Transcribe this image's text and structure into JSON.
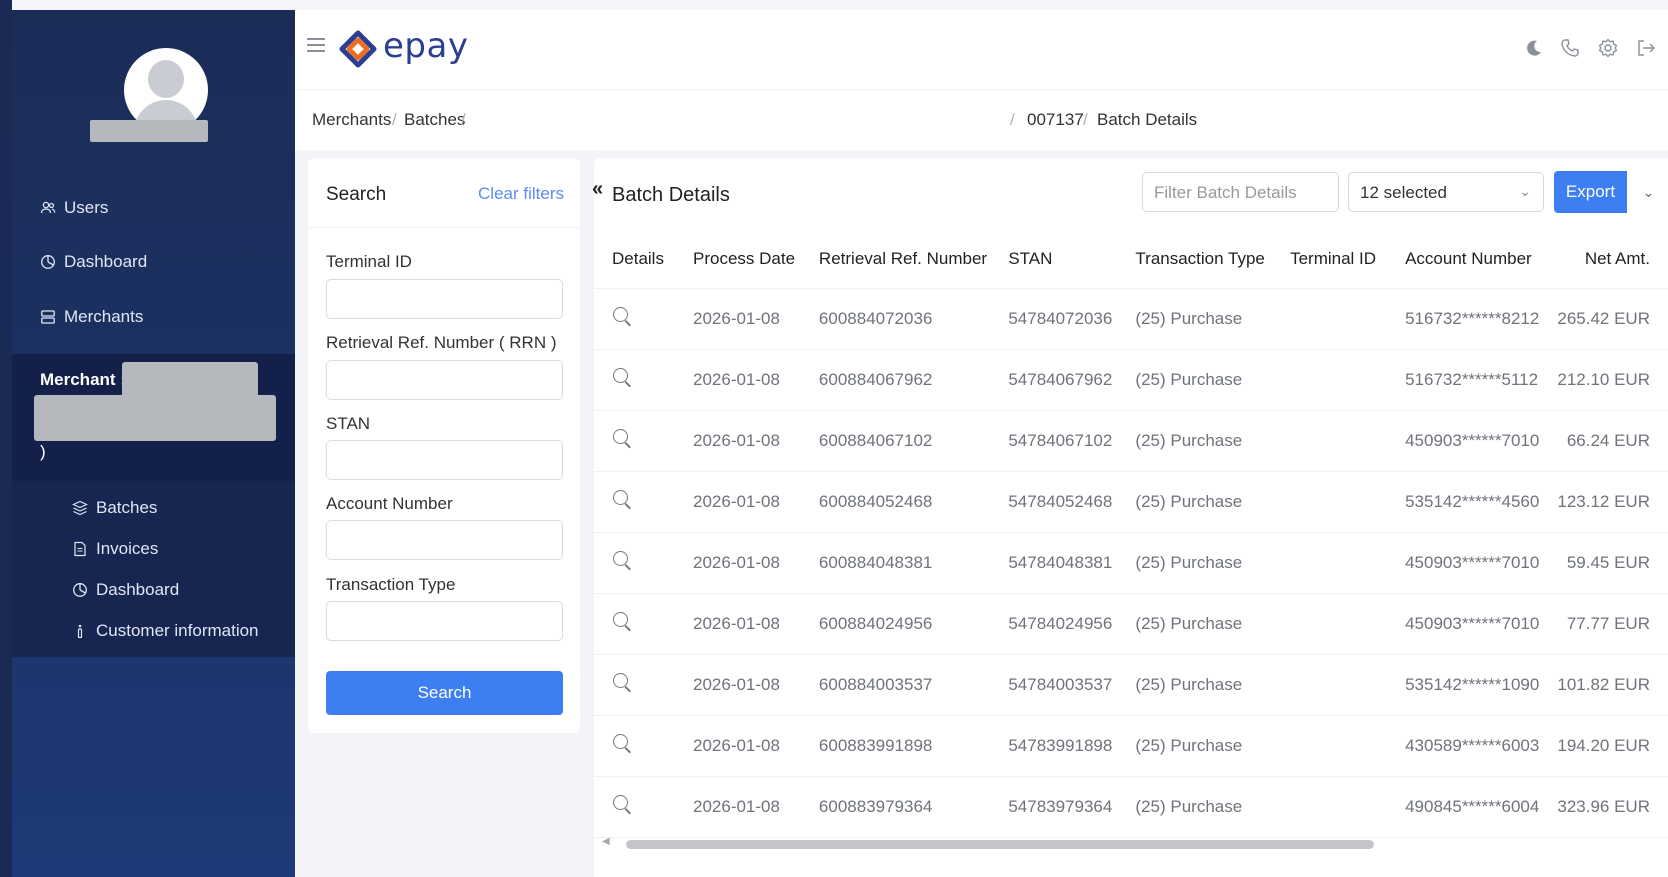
{
  "app": {
    "logo_text": "epay",
    "brand_color": "#2c3e8f",
    "accent_color": "#3d7ef2"
  },
  "sidebar": {
    "items": [
      {
        "label": "Users",
        "icon": "users-icon"
      },
      {
        "label": "Dashboard",
        "icon": "dashboard-icon"
      },
      {
        "label": "Merchants",
        "icon": "merchants-icon"
      }
    ],
    "merchant_label": "Merchant : ",
    "merchant_close": ")",
    "sub_items": [
      {
        "label": "Batches",
        "icon": "batches-icon"
      },
      {
        "label": "Invoices",
        "icon": "invoices-icon"
      },
      {
        "label": "Dashboard",
        "icon": "dashboard-icon"
      },
      {
        "label": "Customer information",
        "icon": "info-icon"
      }
    ]
  },
  "breadcrumb": {
    "merchants": "Merchants",
    "batches": "Batches",
    "batch_no": "007137",
    "current": "Batch Details"
  },
  "search": {
    "title": "Search",
    "clear_filters": "Clear filters",
    "fields": [
      "Terminal ID",
      "Retrieval Ref. Number ( RRN )",
      "STAN",
      "Account Number",
      "Transaction Type"
    ],
    "button": "Search"
  },
  "table_panel": {
    "title": "Batch Details",
    "filter_placeholder": "Filter Batch Details",
    "selected_columns": "12 selected",
    "export": "Export",
    "columns": [
      "Details",
      "Process Date",
      "Retrieval Ref. Number",
      "STAN",
      "Transaction Type",
      "Terminal ID",
      "Account Number",
      "Net Amt."
    ],
    "rows": [
      [
        "2026-01-08",
        "600884072036",
        "54784072036",
        "(25) Purchase",
        "",
        "516732******8212",
        "265.42 EUR"
      ],
      [
        "2026-01-08",
        "600884067962",
        "54784067962",
        "(25) Purchase",
        "",
        "516732******5112",
        "212.10 EUR"
      ],
      [
        "2026-01-08",
        "600884067102",
        "54784067102",
        "(25) Purchase",
        "",
        "450903******7010",
        "66.24 EUR"
      ],
      [
        "2026-01-08",
        "600884052468",
        "54784052468",
        "(25) Purchase",
        "",
        "535142******4560",
        "123.12 EUR"
      ],
      [
        "2026-01-08",
        "600884048381",
        "54784048381",
        "(25) Purchase",
        "",
        "450903******7010",
        "59.45 EUR"
      ],
      [
        "2026-01-08",
        "600884024956",
        "54784024956",
        "(25) Purchase",
        "",
        "450903******7010",
        "77.77 EUR"
      ],
      [
        "2026-01-08",
        "600884003537",
        "54784003537",
        "(25) Purchase",
        "",
        "535142******1090",
        "101.82 EUR"
      ],
      [
        "2026-01-08",
        "600883991898",
        "54783991898",
        "(25) Purchase",
        "",
        "430589******6003",
        "194.20 EUR"
      ],
      [
        "2026-01-08",
        "600883979364",
        "54783979364",
        "(25) Purchase",
        "",
        "490845******6004",
        "323.96 EUR"
      ]
    ]
  },
  "topbar_icons": [
    "moon-icon",
    "phone-icon",
    "gear-icon",
    "logout-icon"
  ]
}
